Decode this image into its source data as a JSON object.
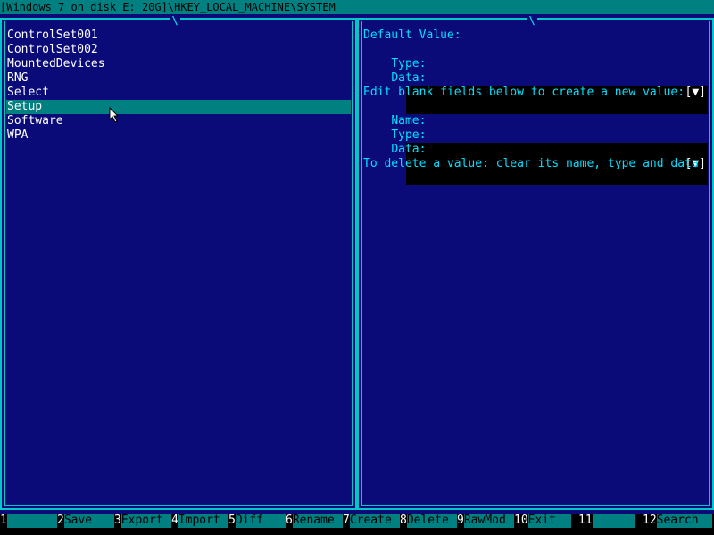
{
  "title": "[Windows 7 on disk E: 20G]\\HKEY_LOCAL_MACHINE\\SYSTEM",
  "scroll_mark": "\\",
  "tree": {
    "items": [
      "ControlSet001",
      "ControlSet002",
      "MountedDevices",
      "RNG",
      "Select",
      "Setup",
      "Software",
      "WPA"
    ],
    "selected": "Setup"
  },
  "value_pane": {
    "default_heading": "Default Value:",
    "type_label": "Type:",
    "data_label": "Data:",
    "name_label": "Name:",
    "default_type_value": "",
    "default_data_value": "",
    "new_name_value": "",
    "new_type_value": "",
    "new_data_value": "",
    "dropdown_glyph": "[▼]",
    "new_heading": "Edit blank fields below to create a new value:",
    "delete_hint": "To delete a value: clear its name, type and data"
  },
  "function_keys": [
    {
      "num": "1",
      "label": ""
    },
    {
      "num": "2",
      "label": "Save"
    },
    {
      "num": "3",
      "label": "Export"
    },
    {
      "num": "4",
      "label": "Import"
    },
    {
      "num": "5",
      "label": "Diff"
    },
    {
      "num": "6",
      "label": "Rename"
    },
    {
      "num": "7",
      "label": "Create"
    },
    {
      "num": "8",
      "label": "Delete"
    },
    {
      "num": "9",
      "label": "RawMod"
    },
    {
      "num": "10",
      "label": "Exit"
    },
    {
      "num": "11",
      "label": ""
    },
    {
      "num": "12",
      "label": "Search"
    }
  ],
  "colors": {
    "background": "#0a0a78",
    "frame": "#00c8c8",
    "highlight": "#008080",
    "label_text": "#00e0ff"
  }
}
